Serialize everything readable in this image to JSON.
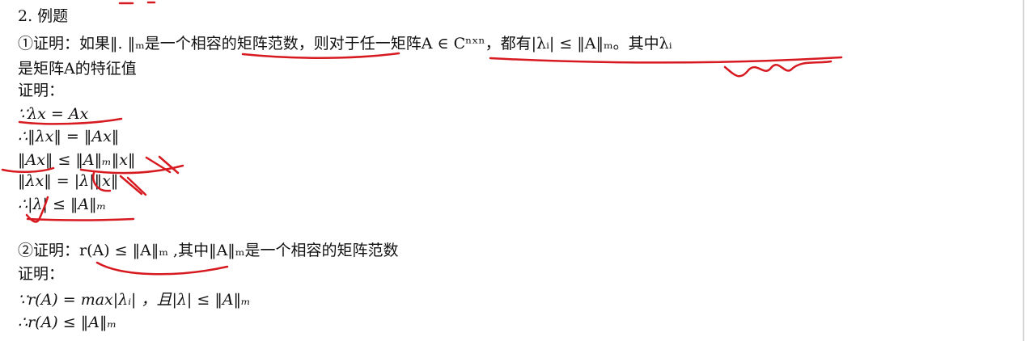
{
  "document": {
    "lines": [
      "2. 例题",
      "①证明：如果‖. ‖ₘ是一个相容的矩阵范数，则对于任一矩阵A ∈ Cⁿˣⁿ，都有|λᵢ| ≤ ‖A‖ₘ。其中λᵢ",
      "是矩阵A的特征值",
      "证明：",
      "∵λx = Ax",
      "∴‖λx‖ = ‖Ax‖",
      "‖Ax‖ ≤ ‖A‖ₘ‖x‖",
      "‖λx‖ = |λ|‖x‖",
      "∴|λ| ≤ ‖A‖ₘ",
      "②证明：r(A) ≤ ‖A‖ₘ ,其中‖A‖ₘ是一个相容的矩阵范数",
      "证明：",
      "∵r(A) = max|λᵢ| ，且|λ| ≤ ‖A‖ₘ",
      "∴r(A) ≤ ‖A‖ₘ"
    ]
  },
  "annotations": {
    "ink_color": "#d71920"
  }
}
